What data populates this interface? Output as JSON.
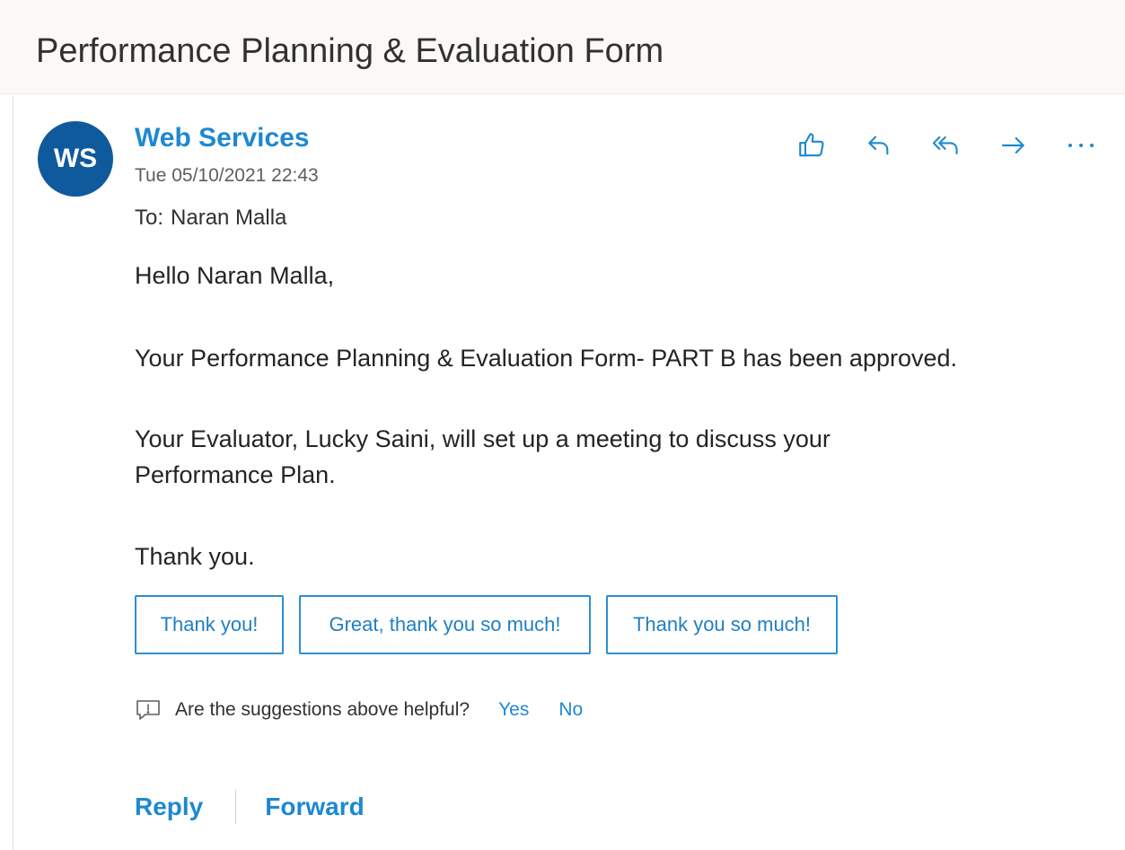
{
  "subject": "Performance Planning & Evaluation Form",
  "sender": {
    "initials": "WS",
    "name": "Web Services",
    "timestamp": "Tue 05/10/2021 22:43",
    "avatar_color": "#0f5a9c"
  },
  "recipient": {
    "label": "To:",
    "name": "Naran Malla"
  },
  "actions": [
    {
      "icon": "like-icon"
    },
    {
      "icon": "reply-icon"
    },
    {
      "icon": "reply-all-icon"
    },
    {
      "icon": "forward-icon"
    },
    {
      "icon": "more-options-icon"
    }
  ],
  "body": {
    "greeting": "Hello Naran Malla,",
    "approved": "Your Performance Planning & Evaluation Form- PART B has been approved.",
    "meeting": "Your Evaluator, Lucky Saini, will set up a meeting to discuss your Performance Plan.",
    "thanks": "Thank you."
  },
  "suggested_replies": [
    "Thank you!",
    "Great, thank you so much!",
    "Thank you so much!"
  ],
  "feedback": {
    "icon": "feedback-icon",
    "question": "Are the suggestions above helpful?",
    "yes": "Yes",
    "no": "No"
  },
  "footer": {
    "reply": "Reply",
    "forward": "Forward"
  },
  "colors": {
    "accent": "#1e88d1",
    "suggestion_border": "#2b8fd0",
    "avatar": "#0f5a9c"
  }
}
